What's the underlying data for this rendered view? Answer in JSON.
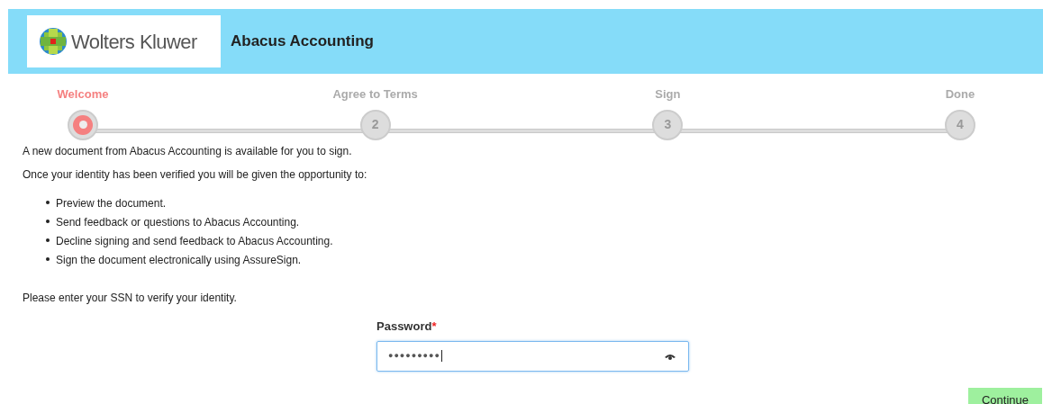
{
  "header": {
    "brand": "Wolters Kluwer",
    "title": "Abacus Accounting"
  },
  "steps": [
    {
      "label": "Welcome",
      "selected": true
    },
    {
      "label": "Agree to Terms",
      "number": "2",
      "selected": false
    },
    {
      "label": "Sign",
      "number": "3",
      "selected": false
    },
    {
      "label": "Done",
      "number": "4",
      "selected": false
    }
  ],
  "intro": "A new document from Abacus Accounting is available for you to sign.",
  "lead": "Once your identity has been verified you will be given the opportunity to:",
  "options": [
    "Preview the document.",
    "Send feedback or questions to Abacus Accounting.",
    "Decline signing and send feedback to Abacus Accounting.",
    "Sign the document electronically using AssureSign."
  ],
  "prompt": "Please enter your SSN to verify your identity.",
  "password": {
    "label": "Password",
    "required_mark": "*",
    "value": "●●●●●●●●●"
  },
  "continue_button": "Continue"
}
